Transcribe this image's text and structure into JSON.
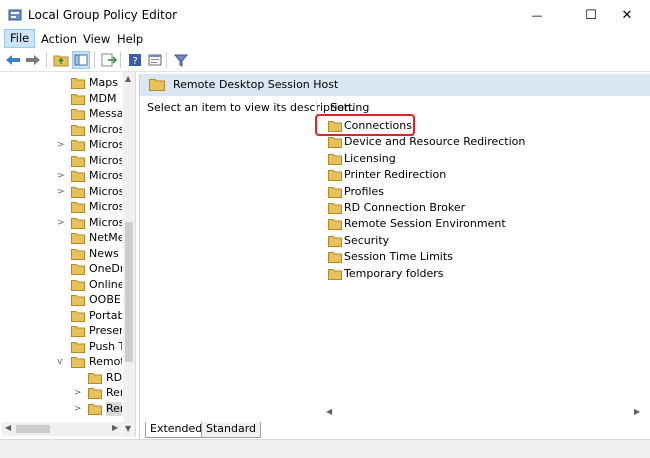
{
  "window": {
    "title": "Local Group Policy Editor",
    "minimize_glyph": "—",
    "maximize_glyph": "☐",
    "close_glyph": "✕"
  },
  "menu": {
    "file": "File",
    "action": "Action",
    "view": "View",
    "help": "Help"
  },
  "toolbar": {
    "icons": [
      "back-arrow-icon",
      "forward-arrow-icon",
      "up-folder-icon",
      "show-hide-tree-icon",
      "export-list-icon",
      "help-icon",
      "properties-icon",
      "filter-icon"
    ]
  },
  "tree": {
    "items": [
      {
        "label": "Maps",
        "expander": ""
      },
      {
        "label": "MDM",
        "expander": ""
      },
      {
        "label": "Messag",
        "expander": ""
      },
      {
        "label": "Micros",
        "expander": ""
      },
      {
        "label": "Micros",
        "expander": ">"
      },
      {
        "label": "Micros",
        "expander": ""
      },
      {
        "label": "Micros",
        "expander": ">"
      },
      {
        "label": "Micros",
        "expander": ">"
      },
      {
        "label": "Micros",
        "expander": ""
      },
      {
        "label": "Micros",
        "expander": ">"
      },
      {
        "label": "NetMe",
        "expander": ""
      },
      {
        "label": "News a",
        "expander": ""
      },
      {
        "label": "OneDr",
        "expander": ""
      },
      {
        "label": "Online",
        "expander": ""
      },
      {
        "label": "OOBE",
        "expander": ""
      },
      {
        "label": "Portab",
        "expander": ""
      },
      {
        "label": "Presen",
        "expander": ""
      },
      {
        "label": "Push T",
        "expander": ""
      },
      {
        "label": "Remot",
        "expander": "v"
      },
      {
        "label": "RD",
        "expander": ""
      },
      {
        "label": "Rer",
        "expander": ">"
      },
      {
        "label": "Rer",
        "expander": ">"
      }
    ],
    "scroll_up": "▲",
    "scroll_down": "▼",
    "scroll_left": "◀",
    "scroll_right": "▶"
  },
  "right": {
    "header": "Remote Desktop Session Host",
    "description": "Select an item to view its description.",
    "column_header": "Setting",
    "settings": [
      "Connections",
      "Device and Resource Redirection",
      "Licensing",
      "Printer Redirection",
      "Profiles",
      "RD Connection Broker",
      "Remote Session Environment",
      "Security",
      "Session Time Limits",
      "Temporary folders"
    ],
    "scroll_left": "◀",
    "scroll_right": "▶"
  },
  "tabs": {
    "extended": "Extended",
    "standard": "Standard"
  },
  "colors": {
    "folder": "#e8c15a",
    "highlight": "#e0202a",
    "header_bar": "#dbe6f4"
  }
}
